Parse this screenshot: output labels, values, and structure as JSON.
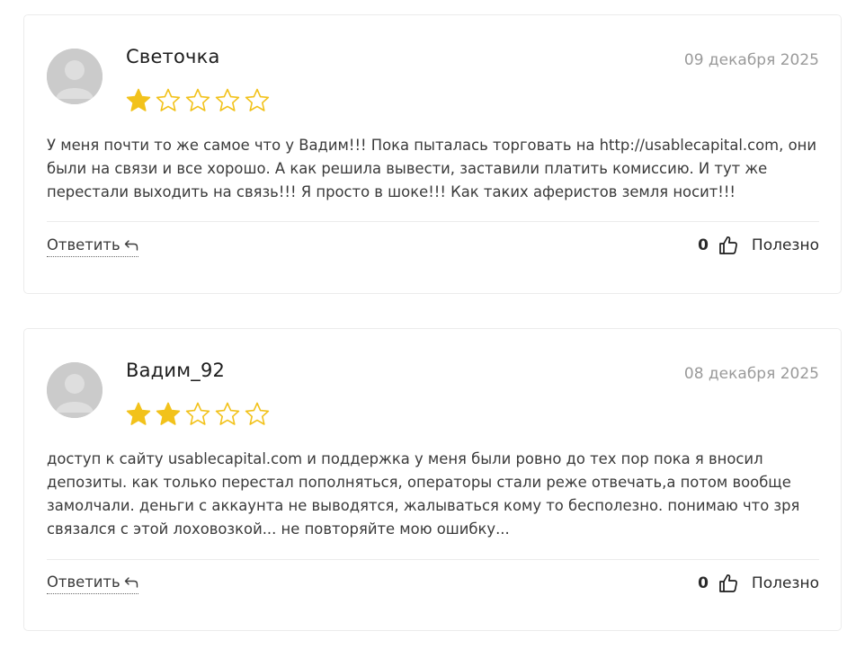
{
  "colors": {
    "star_filled": "#f2c21b",
    "star_empty_outline": "#f2c21b",
    "date_text": "#9a9a9a",
    "avatar_bg": "#c9c9c9"
  },
  "reviews": [
    {
      "author": "Светочка",
      "date": "09 декабря 2025",
      "rating": 1,
      "rating_max": 5,
      "text": "У меня почти то же самое что у Вадим!!! Пока пыталась торговать на http://usablecapital.com, они были на связи и все хорошо. А как решила вывести, заставили платить комиссию. И тут же перестали выходить на связь!!! Я просто в шоке!!! Как таких аферистов земля носит!!!",
      "reply_label": "Ответить",
      "useful_count": "0",
      "useful_label": "Полезно"
    },
    {
      "author": "Вадим_92",
      "date": "08 декабря 2025",
      "rating": 2,
      "rating_max": 5,
      "text": "доступ к сайту usablecapital.com и поддержка у меня были ровно до тех пор пока я вносил депозиты. как только перестал пополняться, операторы стали реже отвечать,а потом вообще замолчали. деньги с аккаунта не выводятся, жалываться кому то бесполезно. понимаю что зря связался с этой лоховозкой... не повторяйте мою ошибку...",
      "reply_label": "Ответить",
      "useful_count": "0",
      "useful_label": "Полезно"
    }
  ],
  "icons": {
    "avatar": "avatar-placeholder-icon",
    "star": "star-icon",
    "reply": "reply-arrow-icon",
    "like": "thumbs-up-icon"
  }
}
